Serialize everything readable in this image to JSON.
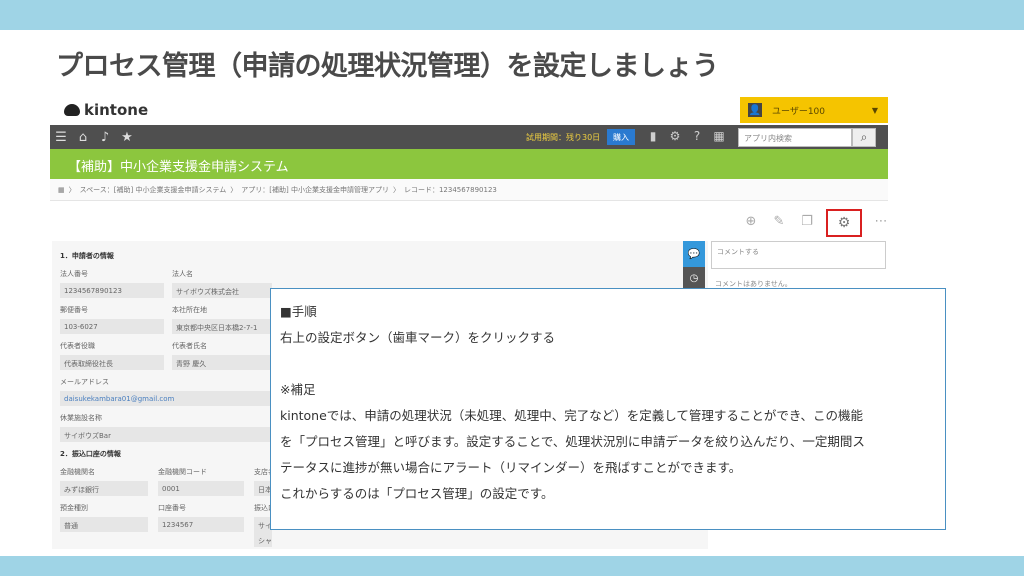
{
  "slide": {
    "title": "プロセス管理（申請の処理状況管理）を設定しましょう"
  },
  "kintone": {
    "logo_text": "kintone",
    "user_name": "ユーザー100",
    "trial_text": "試用期間：残り30日",
    "buy_label": "購入",
    "search_placeholder": "アプリ内検索",
    "app_title": "【補助】中小企業支援金申請システム",
    "breadcrumb": [
      "スペース：[補助] 中小企業支援金申請システム",
      "アプリ：[補助] 中小企業支援金申請管理アプリ",
      "レコード：1234567890123"
    ],
    "comment_placeholder": "コメントする",
    "comment_empty": "コメントはありません。",
    "form": {
      "section1": "1．申請者の情報",
      "section2": "2．振込口座の情報",
      "corp_no_label": "法人番号",
      "corp_no_value": "1234567890123",
      "corp_name_label": "法人名",
      "corp_name_value": "サイボウズ株式会社",
      "zip_label": "郵便番号",
      "zip_value": "103-6027",
      "address_label": "本社所在地",
      "address_value": "東京都中央区日本橋2-7-1",
      "rep_title_label": "代表者役職",
      "rep_title_value": "代表取締役社長",
      "rep_name_label": "代表者氏名",
      "rep_name_value": "青野 慶久",
      "email_label": "メールアドレス",
      "email_value": "daisukekambara01@gmail.com",
      "facility_label": "休業施設名称",
      "facility_value": "サイボウズBar",
      "bank_label": "金融機関名",
      "bank_value": "みずほ銀行",
      "bank_code_label": "金融機関コード",
      "bank_code_value": "0001",
      "branch_label": "支店名",
      "branch_value": "日本",
      "deposit_label": "預金種別",
      "deposit_value": "普通",
      "account_label": "口座番号",
      "account_value": "1234567",
      "holder_label": "振込口座",
      "holder_value": "サイ",
      "holder_value2": "シャ"
    }
  },
  "note": {
    "heading": "■手順",
    "step": "右上の設定ボタン（歯車マーク）をクリックする",
    "supp_heading": "※補足",
    "line1": "kintoneでは、申請の処理状況（未処理、処理中、完了など）を定義して管理することができ、この機能",
    "line2": "を「プロセス管理」と呼びます。設定することで、処理状況別に申請データを絞り込んだり、一定期間ス",
    "line3": "テータスに進捗が無い場合にアラート（リマインダー）を飛ばすことができます。",
    "line4": "これからするのは「プロセス管理」の設定です。"
  },
  "colors": {
    "band": "#9fd4e6",
    "app_band": "#8cc63e",
    "user_bar": "#f5c400",
    "highlight": "#d92020",
    "note_border": "#4a90c2"
  }
}
